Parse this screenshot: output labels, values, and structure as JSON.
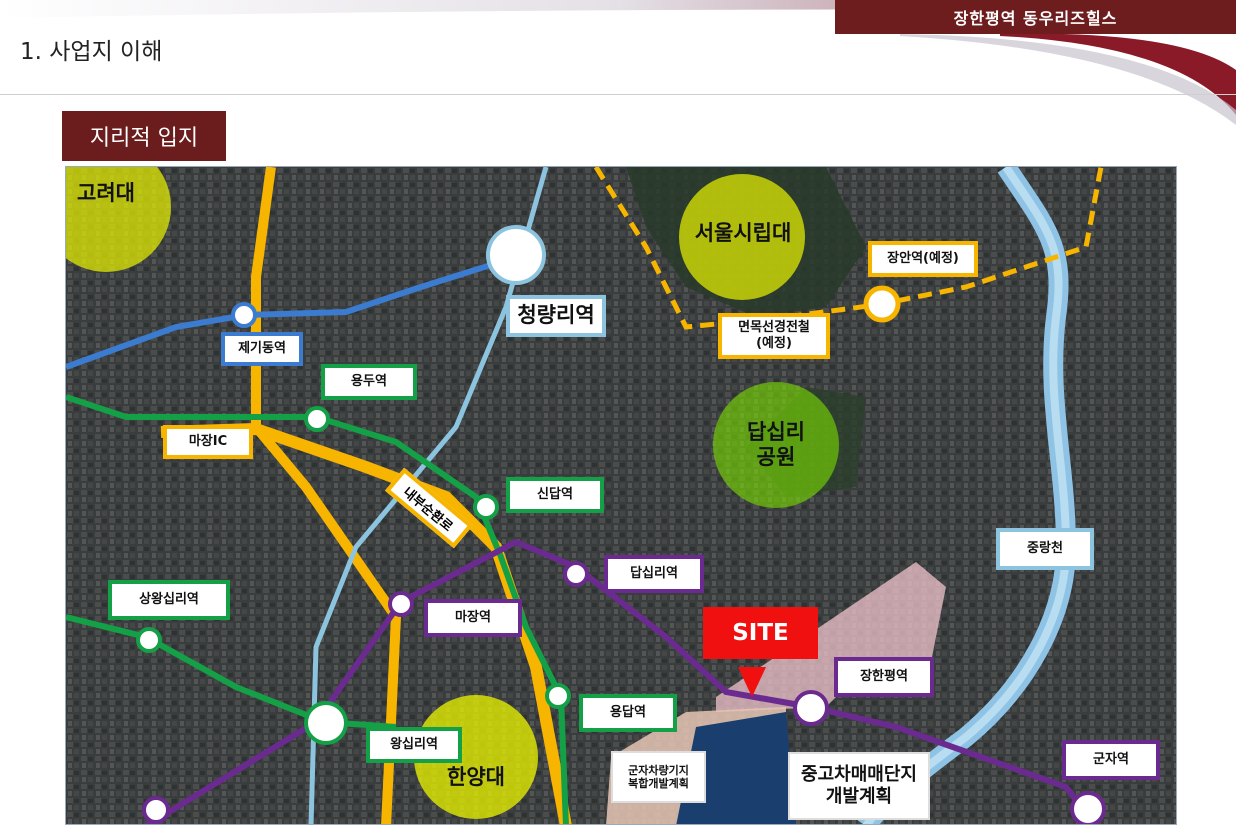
{
  "header": {
    "project_name": "장한평역 동우리즈힐스",
    "section_title": "1. 사업지 이해",
    "subsection_title": "지리적 입지"
  },
  "map": {
    "areas": {
      "korea_univ": "고려대",
      "univ_seoul": "서울시립대",
      "dapsimni_park": "답십리\n공원",
      "hanyang_univ": "한양대"
    },
    "stations": {
      "cheongnyangni": "청량리역",
      "jegi": "제기동역",
      "yongdu": "용두역",
      "majang_ic": "마장IC",
      "sindap": "신답역",
      "dapsimni": "답십리역",
      "majang": "마장역",
      "sangwangsimni": "상왕십리역",
      "wangsimni": "왕십리역",
      "yongdap": "용답역",
      "janghanpyeong": "장한평역",
      "gunja": "군자역",
      "jangan": "장안역(예정)"
    },
    "routes": {
      "inner_ring": "내부순환로",
      "myeonmok_line": "면목선경전철\n(예정)",
      "jungnangcheon": "중랑천"
    },
    "site_label": "SITE",
    "developments": {
      "depot": "군자차량기지\n복합개발계획",
      "used_car": "중고차매매단지\n개발계획"
    }
  },
  "colors": {
    "accent": "#6b1c1c",
    "line2_green": "#14a046",
    "line5_purple": "#6b2a8f",
    "line1_blue": "#3b7bd0",
    "road_yellow": "#f7b500",
    "gyeongui_teal": "#8cc4e0",
    "site_red": "#f01010"
  }
}
